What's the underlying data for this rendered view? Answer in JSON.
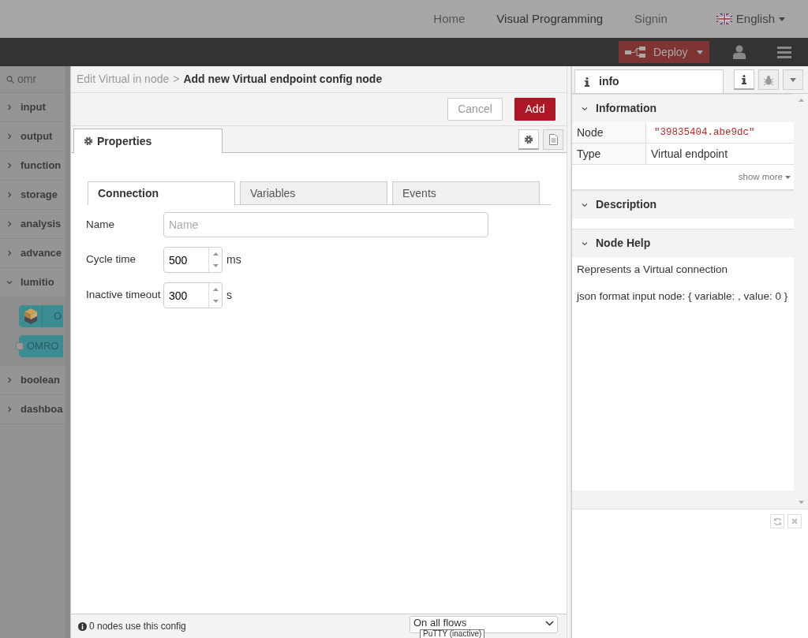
{
  "top_nav": {
    "links": [
      {
        "label": "Home",
        "selected": false
      },
      {
        "label": "Visual Programming",
        "selected": true
      },
      {
        "label": "Signin",
        "selected": false
      }
    ],
    "language": "English"
  },
  "header": {
    "deploy": "Deploy"
  },
  "palette": {
    "search": "omr",
    "categories": [
      {
        "label": "input",
        "expanded": false
      },
      {
        "label": "output",
        "expanded": false
      },
      {
        "label": "function",
        "expanded": false
      },
      {
        "label": "storage",
        "expanded": false
      },
      {
        "label": "analysis",
        "expanded": false
      },
      {
        "label": "advance",
        "expanded": false
      },
      {
        "label": "lumitio",
        "expanded": true,
        "nodes": [
          {
            "label": "O",
            "kind": "input"
          },
          {
            "label": "OMRO",
            "kind": "output"
          }
        ]
      },
      {
        "label": "boolean",
        "expanded": false
      },
      {
        "label": "dashboa",
        "expanded": false
      }
    ]
  },
  "editor": {
    "breadcrumb": {
      "parent": "Edit Virtual in node",
      "separator": ">",
      "title": "Add new Virtual endpoint config node"
    },
    "buttons": [
      {
        "label": "Cancel",
        "kind": "secondary"
      },
      {
        "label": "Add",
        "kind": "primary"
      }
    ],
    "tabs": [
      {
        "label": "Properties",
        "selected": true
      }
    ],
    "tools": [
      {
        "kind": "settings",
        "selected": true
      },
      {
        "kind": "description",
        "selected": false
      }
    ],
    "inner_tabs": [
      {
        "label": "Connection",
        "selected": true
      },
      {
        "label": "Variables",
        "selected": false
      },
      {
        "label": "Events",
        "selected": false
      }
    ],
    "fields": [
      {
        "label": "Name",
        "kind": "text",
        "placeholder": "Name"
      },
      {
        "label": "Cycle time",
        "kind": "number",
        "value": "500",
        "unit": "ms"
      },
      {
        "label": "Inactive timeout",
        "kind": "number",
        "value": "300",
        "unit": "s"
      }
    ],
    "footer": {
      "info": "0 nodes use this config",
      "scope": "On all flows",
      "tooltip": "PuTTY (inactive)"
    }
  },
  "sidebar": {
    "tab": {
      "label": "info",
      "selected": true
    },
    "tools": [
      {
        "kind": "info",
        "selected": true
      },
      {
        "kind": "debug",
        "selected": false
      }
    ],
    "sections": [
      {
        "title": "Information",
        "expanded": true,
        "rows": [
          {
            "label": "Node",
            "value": "\"39835404.abe9dc\"",
            "kind": "code"
          },
          {
            "label": "Type",
            "value": "Virtual endpoint",
            "kind": "text"
          }
        ],
        "more": "show more"
      },
      {
        "title": "Description",
        "expanded": true
      },
      {
        "title": "Node Help",
        "expanded": true,
        "paragraphs": [
          "Represents a Virtual connection",
          "json format input node: { variable: , value: 0 }"
        ]
      }
    ]
  }
}
